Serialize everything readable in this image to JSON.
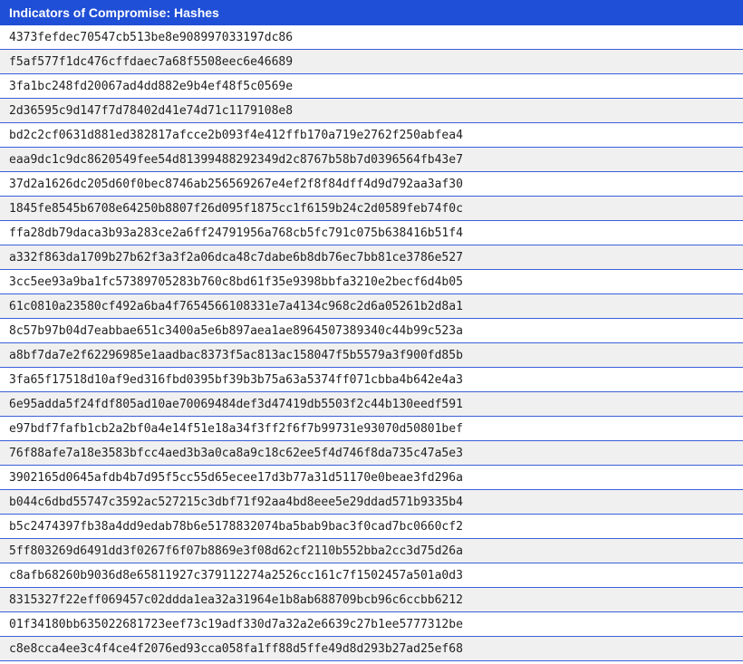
{
  "header": {
    "title": "Indicators of Compromise: Hashes"
  },
  "colors": {
    "header_bg": "#1f4fd6",
    "header_text": "#ffffff",
    "row_border": "#3b5fd9",
    "row_alt_bg": "#f0f0f0"
  },
  "hashes": [
    "4373fefdec70547cb513be8e908997033197dc86",
    "f5af577f1dc476cffdaec7a68f5508eec6e46689",
    "3fa1bc248fd20067ad4dd882e9b4ef48f5c0569e",
    "2d36595c9d147f7d78402d41e74d71c1179108e8",
    "bd2c2cf0631d881ed382817afcce2b093f4e412ffb170a719e2762f250abfea4",
    "eaa9dc1c9dc8620549fee54d81399488292349d2c8767b58b7d0396564fb43e7",
    "37d2a1626dc205d60f0bec8746ab256569267e4ef2f8f84dff4d9d792aa3af30",
    "1845fe8545b6708e64250b8807f26d095f1875cc1f6159b24c2d0589feb74f0c",
    "ffa28db79daca3b93a283ce2a6ff24791956a768cb5fc791c075b638416b51f4",
    "a332f863da1709b27b62f3a3f2a06dca48c7dabe6b8db76ec7bb81ce3786e527",
    "3cc5ee93a9ba1fc57389705283b760c8bd61f35e9398bbfa3210e2becf6d4b05",
    "61c0810a23580cf492a6ba4f7654566108331e7a4134c968c2d6a05261b2d8a1",
    "8c57b97b04d7eabbae651c3400a5e6b897aea1ae8964507389340c44b99c523a",
    "a8bf7da7e2f62296985e1aadbac8373f5ac813ac158047f5b5579a3f900fd85b",
    "3fa65f17518d10af9ed316fbd0395bf39b3b75a63a5374ff071cbba4b642e4a3",
    "6e95adda5f24fdf805ad10ae70069484def3d47419db5503f2c44b130eedf591",
    "e97bdf7fafb1cb2a2bf0a4e14f51e18a34f3ff2f6f7b99731e93070d50801bef",
    "76f88afe7a18e3583bfcc4aed3b3a0ca8a9c18c62ee5f4d746f8da735c47a5e3",
    "3902165d0645afdb4b7d95f5cc55d65ecee17d3b77a31d51170e0beae3fd296a",
    "b044c6dbd55747c3592ac527215c3dbf71f92aa4bd8eee5e29ddad571b9335b4",
    "b5c2474397fb38a4dd9edab78b6e5178832074ba5bab9bac3f0cad7bc0660cf2",
    "5ff803269d6491dd3f0267f6f07b8869e3f08d62cf2110b552bba2cc3d75d26a",
    "c8afb68260b9036d8e65811927c379112274a2526cc161c7f1502457a501a0d3",
    "8315327f22eff069457c02ddda1ea32a31964e1b8ab688709bcb96c6ccbb6212",
    "01f34180bb635022681723eef73c19adf330d7a32a2e6639c27b1ee5777312be",
    "c8e8cca4ee3c4f4ce4f2076ed93cca058fa1ff88d5ffe49d8d293b27ad25ef68"
  ]
}
